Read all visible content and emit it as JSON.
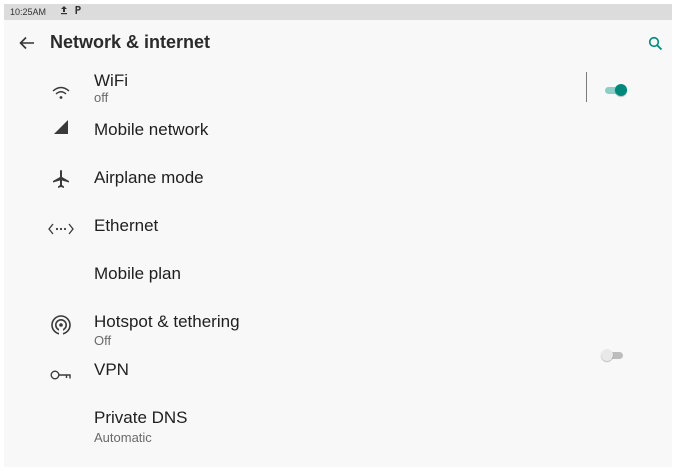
{
  "status_bar": {
    "time": "10:25AM",
    "icons": [
      "upload-icon",
      "parking-icon"
    ]
  },
  "header": {
    "title": "Network & internet",
    "back_icon": "arrow-back-icon",
    "search_icon": "search-icon"
  },
  "colors": {
    "accent": "#00897b",
    "toggle_on_track": "#8ccfc7",
    "toggle_off_thumb": "#e9e9e9",
    "toggle_off_track": "#bdbdbd"
  },
  "items": [
    {
      "label": "WiFi",
      "sub": "off",
      "icon": "wifi-icon",
      "toggle": true
    },
    {
      "label": "Mobile network",
      "icon": "cellular-signal-icon"
    },
    {
      "label": "Airplane mode",
      "icon": "airplane-icon"
    },
    {
      "label": "Ethernet",
      "icon": "ethernet-icon"
    },
    {
      "label": "Mobile plan",
      "toggle": false
    },
    {
      "label": "Hotspot & tethering",
      "sub": "Off",
      "icon": "hotspot-icon"
    },
    {
      "label": "VPN",
      "icon": "vpn-key-icon"
    },
    {
      "label": "Private DNS",
      "sub": "Automatic"
    }
  ]
}
